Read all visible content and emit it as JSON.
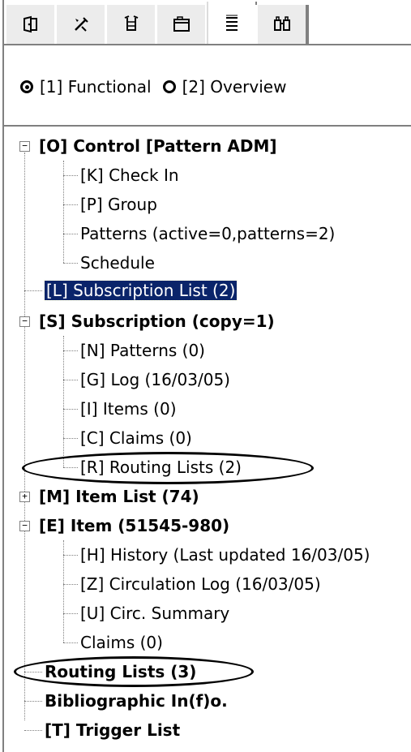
{
  "tabs": [
    {
      "name": "tab-1",
      "icon": "exit-icon"
    },
    {
      "name": "tab-2",
      "icon": "tools-icon"
    },
    {
      "name": "tab-3",
      "icon": "hands-icon"
    },
    {
      "name": "tab-4",
      "icon": "folder-icon"
    },
    {
      "name": "tab-5",
      "icon": "list-icon",
      "active": true
    },
    {
      "name": "tab-6",
      "icon": "binoculars-icon"
    }
  ],
  "view_mode": {
    "options": [
      {
        "label": "[1] Functional",
        "selected": true
      },
      {
        "label": "[2] Overview",
        "selected": false
      }
    ]
  },
  "tree": {
    "control": "[O] Control [Pattern ADM]",
    "check_in": "[K] Check In",
    "group": "[P] Group",
    "patterns_active": "Patterns (active=0,patterns=2)",
    "schedule": "Schedule",
    "subscription_list": "[L] Subscription List (2)",
    "subscription": "[S] Subscription (copy=1)",
    "sub_patterns": "[N] Patterns (0)",
    "sub_log": "[G] Log (16/03/05)",
    "sub_items": "[I] Items (0)",
    "sub_claims": "[C] Claims (0)",
    "sub_routing": "[R] Routing Lists (2)",
    "item_list": "[M] Item List (74)",
    "item": "[E] Item (51545-980)",
    "history": "[H] History (Last updated 16/03/05)",
    "circ_log": "[Z] Circulation Log (16/03/05)",
    "circ_summary": "[U] Circ. Summary",
    "claims": "Claims (0)",
    "routing_lists": "Routing Lists (3)",
    "bib_info": "Bibliographic In(f)o.",
    "trigger_list": "[T] Trigger List"
  },
  "colors": {
    "selection": "#0a246a",
    "tree_line": "#808080",
    "tab_border": "#808080"
  }
}
